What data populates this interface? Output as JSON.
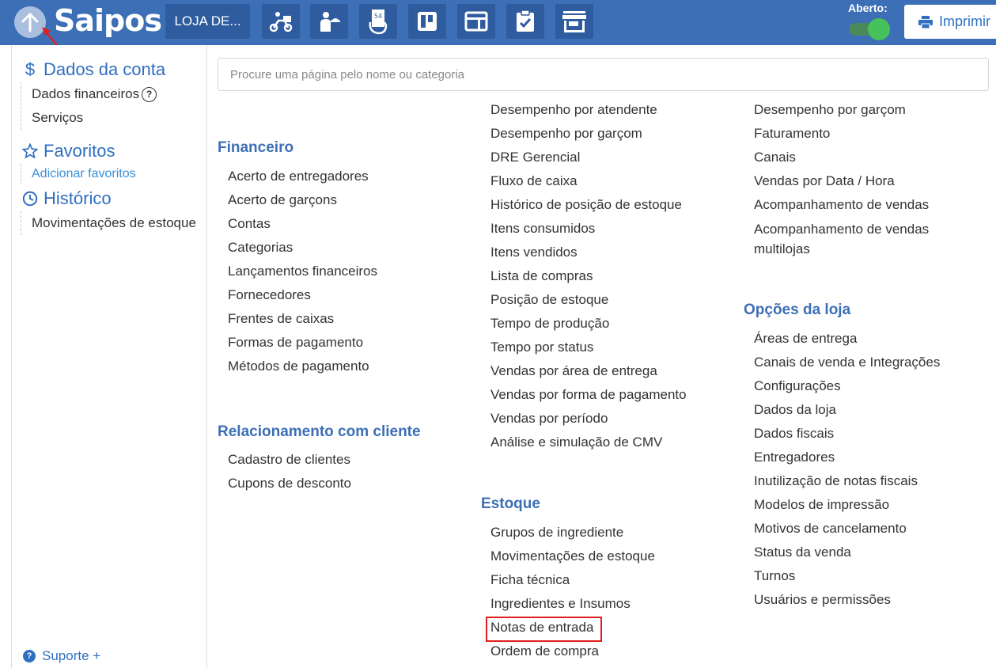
{
  "app": {
    "logo": "Saipos",
    "store_name": "LOJA DE...",
    "aberto_label": "Aberto:",
    "print_label": "Imprimir",
    "toolbar_icons": [
      "delivery-icon",
      "waiter-icon",
      "order-ticket-icon",
      "kanban-board-icon",
      "table-icon",
      "checklist-icon",
      "store-icon"
    ]
  },
  "sidebar": {
    "dados_da_conta": {
      "title": "Dados da conta",
      "items": [
        "Dados financeiros",
        "Serviços"
      ],
      "help_glyph": "?"
    },
    "favoritos": {
      "title": "Favoritos",
      "link": "Adicionar favoritos"
    },
    "historico": {
      "title": "Histórico",
      "items": [
        "Movimentações de estoque"
      ]
    },
    "suporte": "Suporte +"
  },
  "search": {
    "placeholder": "Procure uma página pelo nome ou categoria"
  },
  "main": {
    "financeiro": {
      "title": "Financeiro",
      "items": [
        "Acerto de entregadores",
        "Acerto de garçons",
        "Contas",
        "Categorias",
        "Lançamentos financeiros",
        "Fornecedores",
        "Frentes de caixas",
        "Formas de pagamento",
        "Métodos de pagamento"
      ]
    },
    "relacionamento": {
      "title": "Relacionamento com cliente",
      "items": [
        "Cadastro de clientes",
        "Cupons de desconto"
      ]
    },
    "relatorios_col2": {
      "items": [
        "Desempenho por atendente",
        "Desempenho por garçom",
        "DRE Gerencial",
        "Fluxo de caixa",
        "Histórico de posição de estoque",
        "Itens consumidos",
        "Itens vendidos",
        "Lista de compras",
        "Posição de estoque",
        "Tempo de produção",
        "Tempo por status",
        "Vendas por área de entrega",
        "Vendas por forma de pagamento",
        "Vendas por período",
        "Análise e simulação de CMV"
      ]
    },
    "estoque": {
      "title": "Estoque",
      "items": [
        "Grupos de ingrediente",
        "Movimentações de estoque",
        "Ficha técnica",
        "Ingredientes e Insumos",
        "Notas de entrada",
        "Ordem de compra"
      ]
    },
    "relatorios_col3": {
      "items": [
        "Desempenho por garçom",
        "Faturamento",
        "Canais",
        "Vendas por Data / Hora",
        "Acompanhamento de vendas",
        "Acompanhamento de vendas multilojas"
      ]
    },
    "opcoes_loja": {
      "title": "Opções da loja",
      "items": [
        "Áreas de entrega",
        "Canais de venda e Integrações",
        "Configurações",
        "Dados da loja",
        "Dados fiscais",
        "Entregadores",
        "Inutilização de notas fiscais",
        "Modelos de impressão",
        "Motivos de cancelamento",
        "Status da venda",
        "Turnos",
        "Usuários e permissões"
      ]
    }
  },
  "colors": {
    "topbar": "#3d6fb6",
    "accent": "#2f6fc0",
    "highlight": "#e02020"
  }
}
